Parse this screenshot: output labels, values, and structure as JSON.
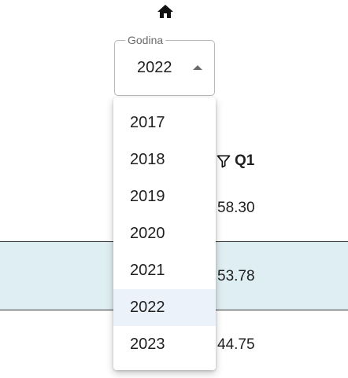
{
  "home": {
    "icon": "home-icon"
  },
  "select": {
    "label": "Godina",
    "value": "2022",
    "arrow_icon": "arrow-up-icon"
  },
  "menu": {
    "options": [
      "2017",
      "2018",
      "2019",
      "2020",
      "2021",
      "2022",
      "2023"
    ],
    "selected": "2022",
    "selected_bg": "#ebf2fa"
  },
  "table": {
    "filter_icon": "filter-icon",
    "column_header": "Q1",
    "rows": [
      {
        "q1": "58.30"
      },
      {
        "q1": "53.78",
        "highlight": "#dfeef2"
      },
      {
        "q1": "44.75"
      }
    ]
  }
}
